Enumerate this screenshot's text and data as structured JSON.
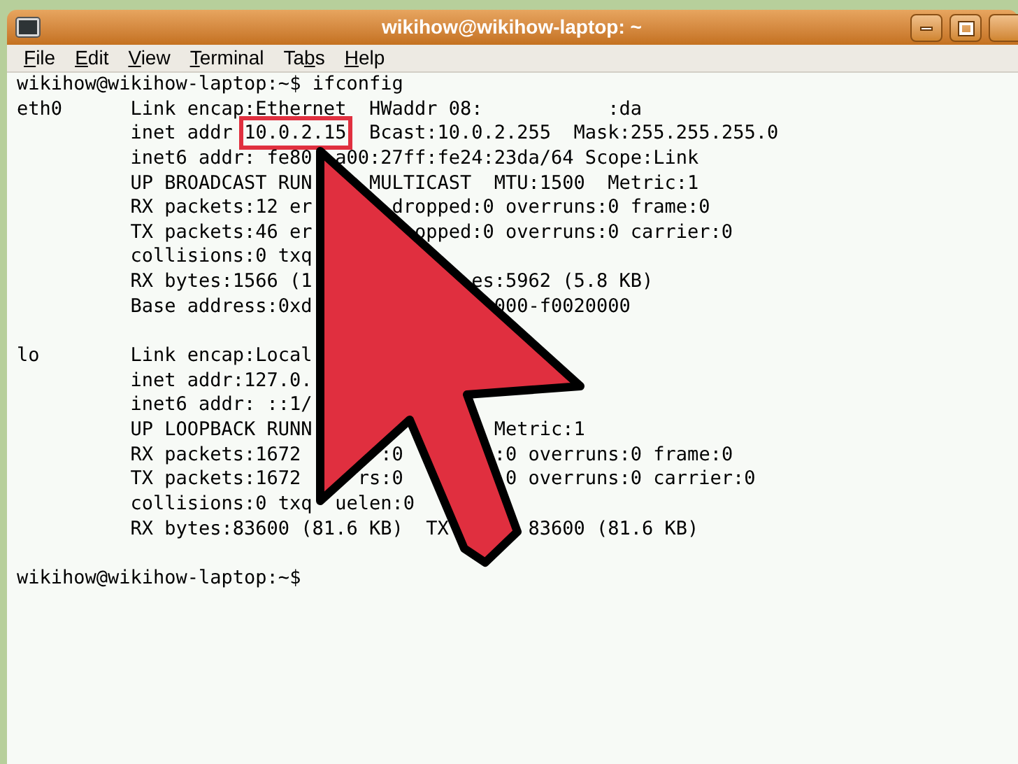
{
  "window": {
    "title": "wikihow@wikihow-laptop: ~"
  },
  "menu": [
    {
      "key": "F",
      "after": "ile"
    },
    {
      "key": "E",
      "after": "dit"
    },
    {
      "key": "V",
      "after": "iew"
    },
    {
      "key": "T",
      "after": "erminal"
    },
    {
      "before": "Ta",
      "key": "b",
      "after": "s"
    },
    {
      "key": "H",
      "after": "elp"
    }
  ],
  "terminal": {
    "lines": [
      {
        "kind": "prompt",
        "text": "wikihow@wikihow-laptop:~$ ifconfig"
      },
      {
        "kind": "detail",
        "iface": "eth0",
        "segments": [
          {
            "text": "Link encap:Ethernet  HWaddr 08:",
            "kind": "plain"
          },
          {
            "text": "           :da",
            "kind": "plain"
          }
        ]
      },
      {
        "kind": "detail",
        "segments": [
          {
            "text": "inet addr",
            "kind": "plain"
          },
          {
            "text": " 10.0.2.15",
            "kind": "boxed"
          },
          {
            "text": "  Bcast:10.0.2.255  Mask:255.255.255.0",
            "kind": "plain"
          }
        ]
      },
      {
        "kind": "detail",
        "segments": [
          {
            "text": "inet6 addr: fe80",
            "kind": "plain"
          },
          {
            "text": "  a00:27ff:fe24:23da/64 Scope:Link",
            "kind": "plain"
          }
        ]
      },
      {
        "kind": "detail",
        "segments": [
          {
            "text": "UP BROADCAST RUN",
            "kind": "plain"
          },
          {
            "text": "     MULTICAST  MTU:1500  Metric:1",
            "kind": "plain"
          }
        ]
      },
      {
        "kind": "detail",
        "segments": [
          {
            "text": "RX packets:12 er",
            "kind": "plain"
          },
          {
            "text": "       dropped:0 overruns:0 frame:0",
            "kind": "plain"
          }
        ]
      },
      {
        "kind": "detail",
        "segments": [
          {
            "text": "TX packets:46 er",
            "kind": "plain"
          },
          {
            "text": "         opped:0 overruns:0 carrier:0",
            "kind": "plain"
          }
        ]
      },
      {
        "kind": "detail",
        "segments": [
          {
            "text": "collisions:0 txq",
            "kind": "plain"
          }
        ]
      },
      {
        "kind": "detail",
        "segments": [
          {
            "text": "RX bytes:1566 (1",
            "kind": "plain"
          },
          {
            "text": "              es:5962 (5.8 KB)",
            "kind": "plain"
          }
        ]
      },
      {
        "kind": "detail",
        "segments": [
          {
            "text": "Base address:0xd",
            "kind": "plain"
          },
          {
            "text": "                000-f0020000",
            "kind": "plain"
          }
        ]
      },
      {
        "kind": "blank"
      },
      {
        "kind": "detail",
        "iface": "lo",
        "segments": [
          {
            "text": "Link encap:Local",
            "kind": "plain"
          }
        ]
      },
      {
        "kind": "detail",
        "segments": [
          {
            "text": "inet addr:127.0.",
            "kind": "plain"
          }
        ]
      },
      {
        "kind": "detail",
        "segments": [
          {
            "text": "inet6 addr: ::1/",
            "kind": "plain"
          }
        ]
      },
      {
        "kind": "detail",
        "segments": [
          {
            "text": "UP LOOPBACK RUNN",
            "kind": "plain"
          },
          {
            "text": "                Metric:1",
            "kind": "plain"
          }
        ]
      },
      {
        "kind": "detail",
        "segments": [
          {
            "text": "RX packets:1672",
            "kind": "plain"
          },
          {
            "text": "       :0",
            "kind": "plain"
          },
          {
            "text": "        :0 overruns:0 frame:0",
            "kind": "plain"
          }
        ]
      },
      {
        "kind": "detail",
        "segments": [
          {
            "text": "TX packets:1672",
            "kind": "plain"
          },
          {
            "text": "     rs:0",
            "kind": "plain"
          },
          {
            "text": "         0 overruns:0 carrier:0",
            "kind": "plain"
          }
        ]
      },
      {
        "kind": "detail",
        "segments": [
          {
            "text": "collisions:0 txq",
            "kind": "plain"
          },
          {
            "text": "  uelen:0",
            "kind": "plain"
          }
        ]
      },
      {
        "kind": "detail",
        "segments": [
          {
            "text": "RX bytes:83600 (81.6 KB)  TX",
            "kind": "plain"
          },
          {
            "text": "       83600 (81.6 KB)",
            "kind": "plain"
          }
        ]
      },
      {
        "kind": "blank"
      },
      {
        "kind": "prompt",
        "text": "wikihow@wikihow-laptop:~$"
      }
    ]
  }
}
